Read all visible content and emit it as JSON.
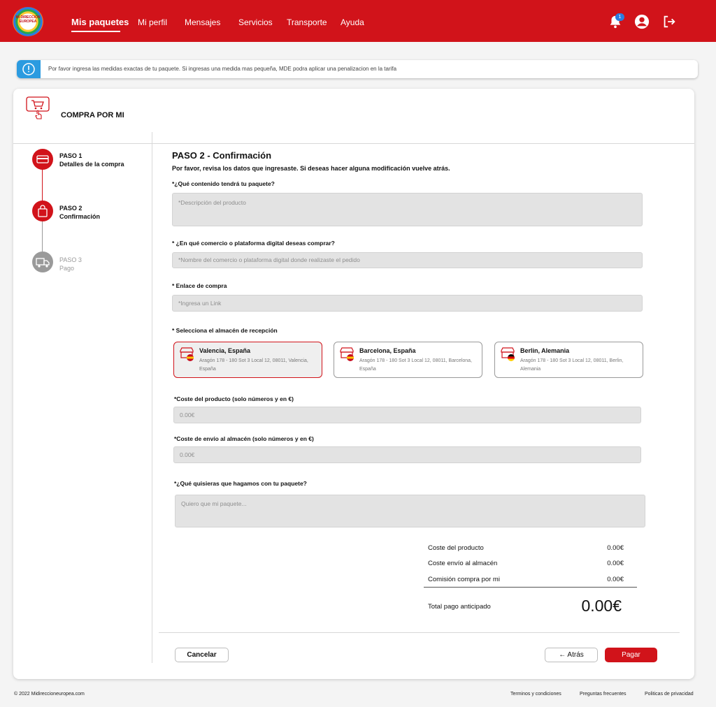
{
  "header": {
    "logo_text": "MI DIRECCION EUROPEA",
    "nav": [
      "Mis paquetes",
      "Mi perfil",
      "Mensajes",
      "Servicios",
      "Transporte",
      "Ayuda"
    ],
    "notification_count": "1",
    "accent": "#d1131a"
  },
  "banner": {
    "text": "Por favor ingresa las medidas exactas de tu paquete. Si ingresas una medida mas pequeña, MDE podra aplicar una penalizacion en la tarifa"
  },
  "card": {
    "title": "COMPRA POR MI"
  },
  "steps": [
    {
      "title": "PASO 1",
      "subtitle": "Detalles de la compra"
    },
    {
      "title": "PASO 2",
      "subtitle": "Confirmación"
    },
    {
      "title": "PASO 3",
      "subtitle": "Pago"
    }
  ],
  "form": {
    "heading": "PASO 2 - Confirmación",
    "lead": "Por favor, revisa los datos que ingresaste. Si deseas hacer alguna modificación vuelve atrás.",
    "content_label": "*¿Qué contenido tendrá tu paquete?",
    "content_placeholder": "*Descripción del producto",
    "store_label": "* ¿En qué comercio o plataforma digital deseas comprar?",
    "store_placeholder": "*Nombre del comercio o plataforma digital donde realizaste el pedido",
    "link_label": "* Enlace de compra",
    "link_placeholder": "*Ingresa un Link",
    "warehouse_label": "* Selecciona el almacén de recepción",
    "product_cost_label": "*Coste del producto  (solo números y en €)",
    "product_cost_value": "0.00€",
    "shipping_cost_label": "*Coste de envío al almacén  (solo números y en €)",
    "shipping_cost_value": "0.00€",
    "instructions_label": "*¿Qué quisieras que hagamos con tu paquete?",
    "instructions_placeholder": "Quiero que mi paquete..."
  },
  "warehouses": [
    {
      "name": "Valencia, España",
      "address": "Aragón 178 - 180 Sot 3 Local 12, 08011, Valencia, España",
      "selected": true,
      "flag": "es"
    },
    {
      "name": "Barcelona, España",
      "address": "Aragón 178 - 180 Sot 3 Local 12, 08011, Barcelona, España",
      "selected": false,
      "flag": "es"
    },
    {
      "name": "Berlin, Alemania",
      "address": "Aragón 178 - 180 Sot 3 Local 12, 08011, Berlin, Alemania",
      "selected": false,
      "flag": "de"
    }
  ],
  "totals": {
    "rows": [
      {
        "label": "Coste del producto",
        "value": "0.00€"
      },
      {
        "label": "Coste envío al almacén",
        "value": "0.00€"
      },
      {
        "label": "Comisión compra por mi",
        "value": "0.00€"
      }
    ],
    "total_label": "Total pago anticipado",
    "total_value": "0.00€"
  },
  "buttons": {
    "cancel": "Cancelar",
    "back": "← Atrás",
    "pay": "Pagar"
  },
  "footer": {
    "copyright": "© 2022 Midireccioneuropea.com",
    "links": [
      "Terminos y condiciones",
      "Preguntas frecuentes",
      "Politicas de privacidad"
    ]
  }
}
